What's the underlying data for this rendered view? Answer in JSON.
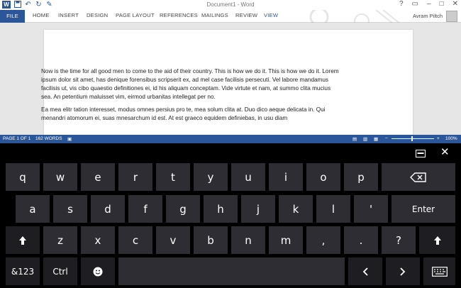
{
  "window": {
    "title": "Document1 - Word",
    "user": "Avram Piltch"
  },
  "ribbon": {
    "tabs": [
      "FILE",
      "HOME",
      "INSERT",
      "DESIGN",
      "PAGE LAYOUT",
      "REFERENCES",
      "MAILINGS",
      "REVIEW",
      "VIEW"
    ],
    "active": "VIEW"
  },
  "document": {
    "paragraph1": "Now is the time for all good men to come to the aid of their country. This is how we do it. This is how we do it. Lorem ipsum dolor sit amet, has denique forensibus scripserit ex, ad mel case facilisis persecuti. Vel labore mandamus facilisis ut, vis cibo quaestio definitiones ei, id his aliquam conceptam. Vide virtute et nam, at summo clita mucius sea. An petentium maluisset vim, eirmod urbanitas intellegat per no.",
    "paragraph2": "Ea mea elitr tation interesset, modus omnes persius pro te, mea solum clita at. Duo dico aeque delicata in. Qui menandri atomorum ei, suas mnesarchum id est. At est graeco equidem definiebas, in usu diam"
  },
  "statusbar": {
    "page": "PAGE 1 OF 1",
    "words": "162 WORDS",
    "zoom": "100%",
    "minus": "−",
    "plus": "+"
  },
  "keyboard": {
    "row1": [
      "q",
      "w",
      "e",
      "r",
      "t",
      "y",
      "u",
      "i",
      "o",
      "p"
    ],
    "row2": [
      "a",
      "s",
      "d",
      "f",
      "g",
      "h",
      "j",
      "k",
      "l",
      "'"
    ],
    "row3": [
      "z",
      "x",
      "c",
      "v",
      "b",
      "n",
      "m",
      ",",
      ".",
      "?"
    ],
    "enter": "Enter",
    "symbols": "&123",
    "ctrl": "Ctrl",
    "close": "✕"
  },
  "colors": {
    "accent": "#2b579a",
    "key": "#2d2d33",
    "key_dark": "#1e1e22",
    "keyboard_bg": "#000000"
  }
}
